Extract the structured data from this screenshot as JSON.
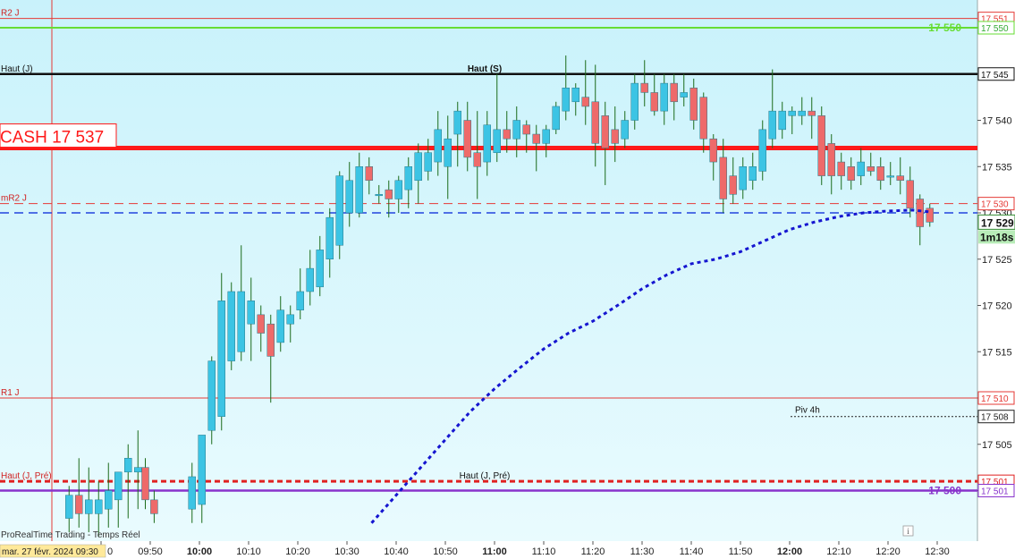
{
  "chart_data": {
    "type": "candlestick",
    "title": "",
    "xlabel": "",
    "ylabel": "",
    "ylim": [
      17496.5,
      17554.5
    ],
    "y_ticks": [
      17500,
      17505,
      17510,
      17515,
      17520,
      17525,
      17530,
      17535,
      17540,
      17545,
      17550
    ],
    "x_ticks": [
      {
        "m": -10,
        "label": "9:40",
        "bold": false
      },
      {
        "m": 0,
        "label": "09:50",
        "bold": false
      },
      {
        "m": 10,
        "label": "10:00",
        "bold": true
      },
      {
        "m": 20,
        "label": "10:10",
        "bold": false
      },
      {
        "m": 30,
        "label": "10:20",
        "bold": false
      },
      {
        "m": 40,
        "label": "10:30",
        "bold": false
      },
      {
        "m": 50,
        "label": "10:40",
        "bold": false
      },
      {
        "m": 60,
        "label": "10:50",
        "bold": false
      },
      {
        "m": 70,
        "label": "11:00",
        "bold": true
      },
      {
        "m": 80,
        "label": "11:10",
        "bold": false
      },
      {
        "m": 90,
        "label": "11:20",
        "bold": false
      },
      {
        "m": 100,
        "label": "11:30",
        "bold": false
      },
      {
        "m": 110,
        "label": "11:40",
        "bold": false
      },
      {
        "m": 120,
        "label": "11:50",
        "bold": false
      },
      {
        "m": 130,
        "label": "12:00",
        "bold": true
      },
      {
        "m": 140,
        "label": "12:10",
        "bold": false
      },
      {
        "m": 150,
        "label": "12:20",
        "bold": false
      },
      {
        "m": 160,
        "label": "12:30",
        "bold": false
      }
    ],
    "date_label": "mar. 27 févr. 2024 09:30",
    "watermark": "ProRealTime Trading - Temps Réel",
    "candles": [
      {
        "m": -16.5,
        "o": 17497.0,
        "h": 17500.5,
        "l": 17495.5,
        "c": 17499.5
      },
      {
        "m": -14.5,
        "o": 17499.5,
        "h": 17503.5,
        "l": 17496.0,
        "c": 17497.5
      },
      {
        "m": -12.5,
        "o": 17497.5,
        "h": 17502.5,
        "l": 17495.5,
        "c": 17499.0
      },
      {
        "m": -10.5,
        "o": 17497.5,
        "h": 17501.0,
        "l": 17495.0,
        "c": 17499.0
      },
      {
        "m": -8.5,
        "o": 17498.0,
        "h": 17503.0,
        "l": 17496.0,
        "c": 17500.0
      },
      {
        "m": -6.5,
        "o": 17499.0,
        "h": 17502.0,
        "l": 17496.0,
        "c": 17502.0
      },
      {
        "m": -4.5,
        "o": 17502.0,
        "h": 17505.0,
        "l": 17497.0,
        "c": 17503.5
      },
      {
        "m": -2.5,
        "o": 17502.0,
        "h": 17506.5,
        "l": 17498.0,
        "c": 17502.5
      },
      {
        "m": -1.0,
        "o": 17502.5,
        "h": 17503.5,
        "l": 17498.0,
        "c": 17499.0
      },
      {
        "m": 0.8,
        "o": 17499.0,
        "h": 17500.0,
        "l": 17496.5,
        "c": 17497.5
      },
      {
        "m": 8.5,
        "o": 17498.0,
        "h": 17503.0,
        "l": 17496.5,
        "c": 17501.5
      },
      {
        "m": 10.5,
        "o": 17498.5,
        "h": 17505.5,
        "l": 17496.5,
        "c": 17506.0
      },
      {
        "m": 12.5,
        "o": 17506.5,
        "h": 17514.5,
        "l": 17505.0,
        "c": 17514.0
      },
      {
        "m": 14.5,
        "o": 17508.0,
        "h": 17523.5,
        "l": 17506.5,
        "c": 17520.5
      },
      {
        "m": 16.5,
        "o": 17514.0,
        "h": 17522.5,
        "l": 17513.0,
        "c": 17521.5
      },
      {
        "m": 18.5,
        "o": 17515.0,
        "h": 17526.5,
        "l": 17514.0,
        "c": 17521.5
      },
      {
        "m": 20.5,
        "o": 17518.0,
        "h": 17523.0,
        "l": 17514.0,
        "c": 17520.5
      },
      {
        "m": 22.5,
        "o": 17519.0,
        "h": 17520.0,
        "l": 17515.0,
        "c": 17517.0
      },
      {
        "m": 24.5,
        "o": 17518.0,
        "h": 17519.0,
        "l": 17509.5,
        "c": 17514.5
      },
      {
        "m": 26.5,
        "o": 17516.0,
        "h": 17521.0,
        "l": 17515.0,
        "c": 17519.5
      },
      {
        "m": 28.5,
        "o": 17518.0,
        "h": 17520.0,
        "l": 17516.0,
        "c": 17519.0
      },
      {
        "m": 30.5,
        "o": 17519.5,
        "h": 17524.0,
        "l": 17518.5,
        "c": 17521.5
      },
      {
        "m": 32.5,
        "o": 17521.5,
        "h": 17526.0,
        "l": 17520.0,
        "c": 17524.0
      },
      {
        "m": 34.5,
        "o": 17522.0,
        "h": 17527.5,
        "l": 17521.0,
        "c": 17526.0
      },
      {
        "m": 36.5,
        "o": 17525.0,
        "h": 17530.5,
        "l": 17523.0,
        "c": 17529.5
      },
      {
        "m": 38.5,
        "o": 17526.5,
        "h": 17534.5,
        "l": 17525.0,
        "c": 17534.0
      },
      {
        "m": 40.5,
        "o": 17530.0,
        "h": 17535.5,
        "l": 17528.5,
        "c": 17533.5
      },
      {
        "m": 42.5,
        "o": 17530.0,
        "h": 17536.5,
        "l": 17529.5,
        "c": 17535.0
      },
      {
        "m": 44.5,
        "o": 17535.0,
        "h": 17536.0,
        "l": 17532.0,
        "c": 17533.5
      },
      {
        "m": 46.5,
        "o": 17532.0,
        "h": 17533.0,
        "l": 17531.0,
        "c": 17532.0
      },
      {
        "m": 48.5,
        "o": 17532.5,
        "h": 17533.5,
        "l": 17529.5,
        "c": 17531.5
      },
      {
        "m": 50.5,
        "o": 17531.5,
        "h": 17534.0,
        "l": 17530.0,
        "c": 17533.5
      },
      {
        "m": 52.5,
        "o": 17532.5,
        "h": 17536.0,
        "l": 17530.5,
        "c": 17535.0
      },
      {
        "m": 54.5,
        "o": 17533.5,
        "h": 17537.5,
        "l": 17531.0,
        "c": 17536.5
      },
      {
        "m": 56.5,
        "o": 17534.5,
        "h": 17538.0,
        "l": 17533.5,
        "c": 17536.5
      },
      {
        "m": 58.5,
        "o": 17535.5,
        "h": 17541.0,
        "l": 17534.0,
        "c": 17539.0
      },
      {
        "m": 60.5,
        "o": 17535.0,
        "h": 17540.5,
        "l": 17531.5,
        "c": 17538.0
      },
      {
        "m": 62.5,
        "o": 17538.5,
        "h": 17542.0,
        "l": 17535.0,
        "c": 17541.0
      },
      {
        "m": 64.5,
        "o": 17540.0,
        "h": 17542.0,
        "l": 17534.5,
        "c": 17536.0
      },
      {
        "m": 66.5,
        "o": 17536.5,
        "h": 17541.0,
        "l": 17531.5,
        "c": 17535.0
      },
      {
        "m": 68.5,
        "o": 17535.5,
        "h": 17541.0,
        "l": 17534.0,
        "c": 17539.5
      },
      {
        "m": 70.5,
        "o": 17536.5,
        "h": 17545.0,
        "l": 17535.5,
        "c": 17539.0
      },
      {
        "m": 72.5,
        "o": 17539.0,
        "h": 17541.0,
        "l": 17536.5,
        "c": 17538.0
      },
      {
        "m": 74.5,
        "o": 17538.0,
        "h": 17541.5,
        "l": 17536.0,
        "c": 17540.0
      },
      {
        "m": 76.5,
        "o": 17539.5,
        "h": 17540.0,
        "l": 17536.5,
        "c": 17538.5
      },
      {
        "m": 78.5,
        "o": 17538.5,
        "h": 17539.5,
        "l": 17534.5,
        "c": 17537.5
      },
      {
        "m": 80.5,
        "o": 17537.5,
        "h": 17539.5,
        "l": 17536.0,
        "c": 17539.0
      },
      {
        "m": 82.5,
        "o": 17539.0,
        "h": 17542.0,
        "l": 17538.5,
        "c": 17541.5
      },
      {
        "m": 84.5,
        "o": 17541.0,
        "h": 17547.0,
        "l": 17540.0,
        "c": 17543.5
      },
      {
        "m": 86.5,
        "o": 17542.0,
        "h": 17544.0,
        "l": 17540.5,
        "c": 17543.5
      },
      {
        "m": 88.5,
        "o": 17542.5,
        "h": 17546.5,
        "l": 17539.5,
        "c": 17541.5
      },
      {
        "m": 90.5,
        "o": 17542.0,
        "h": 17546.0,
        "l": 17535.0,
        "c": 17537.5
      },
      {
        "m": 92.5,
        "o": 17540.5,
        "h": 17542.0,
        "l": 17533.0,
        "c": 17537.0
      },
      {
        "m": 94.5,
        "o": 17539.0,
        "h": 17541.5,
        "l": 17535.5,
        "c": 17537.5
      },
      {
        "m": 96.5,
        "o": 17538.0,
        "h": 17541.0,
        "l": 17537.0,
        "c": 17540.0
      },
      {
        "m": 98.5,
        "o": 17540.0,
        "h": 17545.0,
        "l": 17539.0,
        "c": 17544.0
      },
      {
        "m": 100.5,
        "o": 17544.0,
        "h": 17546.5,
        "l": 17541.5,
        "c": 17543.0
      },
      {
        "m": 102.5,
        "o": 17543.0,
        "h": 17545.0,
        "l": 17540.5,
        "c": 17541.0
      },
      {
        "m": 104.5,
        "o": 17541.0,
        "h": 17545.0,
        "l": 17539.5,
        "c": 17544.0
      },
      {
        "m": 106.5,
        "o": 17544.0,
        "h": 17545.0,
        "l": 17540.0,
        "c": 17542.0
      },
      {
        "m": 108.5,
        "o": 17542.5,
        "h": 17545.0,
        "l": 17541.5,
        "c": 17543.0
      },
      {
        "m": 110.5,
        "o": 17543.5,
        "h": 17544.5,
        "l": 17539.0,
        "c": 17540.0
      },
      {
        "m": 112.5,
        "o": 17542.5,
        "h": 17543.0,
        "l": 17536.5,
        "c": 17538.0
      },
      {
        "m": 114.5,
        "o": 17538.0,
        "h": 17538.5,
        "l": 17533.5,
        "c": 17535.5
      },
      {
        "m": 116.5,
        "o": 17536.0,
        "h": 17538.0,
        "l": 17530.0,
        "c": 17531.5
      },
      {
        "m": 118.5,
        "o": 17534.0,
        "h": 17536.0,
        "l": 17531.0,
        "c": 17532.0
      },
      {
        "m": 120.5,
        "o": 17532.5,
        "h": 17536.0,
        "l": 17531.5,
        "c": 17535.0
      },
      {
        "m": 122.5,
        "o": 17533.5,
        "h": 17536.5,
        "l": 17532.5,
        "c": 17535.0
      },
      {
        "m": 124.5,
        "o": 17534.5,
        "h": 17540.0,
        "l": 17533.5,
        "c": 17539.0
      },
      {
        "m": 126.5,
        "o": 17538.0,
        "h": 17545.5,
        "l": 17537.0,
        "c": 17541.0
      },
      {
        "m": 128.5,
        "o": 17539.0,
        "h": 17542.0,
        "l": 17538.0,
        "c": 17541.0
      },
      {
        "m": 130.5,
        "o": 17540.5,
        "h": 17541.5,
        "l": 17538.5,
        "c": 17541.0
      },
      {
        "m": 132.5,
        "o": 17540.5,
        "h": 17542.5,
        "l": 17539.5,
        "c": 17541.0
      },
      {
        "m": 134.5,
        "o": 17541.0,
        "h": 17542.5,
        "l": 17538.0,
        "c": 17540.5
      },
      {
        "m": 136.5,
        "o": 17540.5,
        "h": 17541.5,
        "l": 17533.0,
        "c": 17534.0
      },
      {
        "m": 138.5,
        "o": 17537.5,
        "h": 17538.5,
        "l": 17532.0,
        "c": 17534.0
      },
      {
        "m": 140.5,
        "o": 17535.5,
        "h": 17536.5,
        "l": 17532.5,
        "c": 17534.0
      },
      {
        "m": 142.5,
        "o": 17535.0,
        "h": 17536.0,
        "l": 17532.5,
        "c": 17533.5
      },
      {
        "m": 144.5,
        "o": 17534.0,
        "h": 17537.0,
        "l": 17533.0,
        "c": 17535.5
      },
      {
        "m": 146.5,
        "o": 17535.0,
        "h": 17536.5,
        "l": 17534.0,
        "c": 17534.5
      },
      {
        "m": 148.5,
        "o": 17535.0,
        "h": 17536.0,
        "l": 17532.5,
        "c": 17533.5
      },
      {
        "m": 150.5,
        "o": 17534.0,
        "h": 17535.5,
        "l": 17533.0,
        "c": 17534.0
      },
      {
        "m": 152.5,
        "o": 17534.0,
        "h": 17536.0,
        "l": 17532.0,
        "c": 17533.5
      },
      {
        "m": 154.5,
        "o": 17533.5,
        "h": 17535.0,
        "l": 17529.5,
        "c": 17530.5
      },
      {
        "m": 156.5,
        "o": 17531.5,
        "h": 17532.0,
        "l": 17526.5,
        "c": 17528.5
      },
      {
        "m": 158.5,
        "o": 17530.5,
        "h": 17531.0,
        "l": 17528.5,
        "c": 17529.0
      }
    ],
    "moving_average": [
      {
        "m": 45.0,
        "v": 17496.5
      },
      {
        "m": 50.0,
        "v": 17499.5
      },
      {
        "m": 55.0,
        "v": 17502.5
      },
      {
        "m": 60.0,
        "v": 17505.5
      },
      {
        "m": 65.0,
        "v": 17508.5
      },
      {
        "m": 70.0,
        "v": 17511.0
      },
      {
        "m": 75.0,
        "v": 17513.2
      },
      {
        "m": 80.0,
        "v": 17515.3
      },
      {
        "m": 85.0,
        "v": 17517.0
      },
      {
        "m": 90.0,
        "v": 17518.3
      },
      {
        "m": 95.0,
        "v": 17520.0
      },
      {
        "m": 100.0,
        "v": 17521.8
      },
      {
        "m": 105.0,
        "v": 17523.3
      },
      {
        "m": 110.0,
        "v": 17524.5
      },
      {
        "m": 115.0,
        "v": 17525.0
      },
      {
        "m": 120.0,
        "v": 17525.8
      },
      {
        "m": 125.0,
        "v": 17527.0
      },
      {
        "m": 130.0,
        "v": 17528.2
      },
      {
        "m": 135.0,
        "v": 17529.0
      },
      {
        "m": 140.0,
        "v": 17529.6
      },
      {
        "m": 145.0,
        "v": 17530.0
      },
      {
        "m": 150.0,
        "v": 17530.2
      },
      {
        "m": 155.0,
        "v": 17530.3
      },
      {
        "m": 158.5,
        "v": 17530.1
      }
    ],
    "levels": [
      {
        "name": "R2 J",
        "value": 17551,
        "color": "#e53935",
        "style": "solid",
        "width": 1,
        "label": "R2 J",
        "tag": "17 551"
      },
      {
        "name": "green",
        "value": 17550,
        "color": "#66dd33",
        "style": "solid",
        "width": 2,
        "label": "",
        "tag": "17 550",
        "inline_text": "17 550"
      },
      {
        "name": "Haut (J)",
        "value": 17545,
        "color": "#111111",
        "style": "solid",
        "width": 2.5,
        "label": "Haut (J)",
        "tag": "17 545",
        "mid_text": "Haut (S)"
      },
      {
        "name": "CASH",
        "value": 17537,
        "color": "#ff1a1a",
        "style": "solid",
        "width": 5,
        "label": "",
        "tag": ""
      },
      {
        "name": "mR2 J",
        "value": 17531,
        "color": "#e53935",
        "style": "dashed",
        "width": 1,
        "label": "mR2 J",
        "tag": "17 530"
      },
      {
        "name": "blue",
        "value": 17530,
        "color": "#2244dd",
        "style": "dashed",
        "width": 1.5,
        "label": "",
        "tag": ""
      },
      {
        "name": "R1 J",
        "value": 17510,
        "color": "#e53935",
        "style": "solid",
        "width": 1,
        "label": "R1 J",
        "tag": "17 510"
      },
      {
        "name": "Piv 4h",
        "value": 17508,
        "color": "#222222",
        "style": "dotted",
        "width": 1,
        "label": "",
        "tag": "17 508",
        "piv_text": "Piv 4h"
      },
      {
        "name": "Haut (J, Pré)",
        "value": 17501,
        "color": "#e02020",
        "style": "dashed",
        "width": 3,
        "label": "Haut (J, Pré)",
        "tag": "17 501",
        "mid_text": "Haut (J, Pré)"
      },
      {
        "name": "purple",
        "value": 17500,
        "color": "#8833cc",
        "style": "solid",
        "width": 2.5,
        "label": "",
        "tag": "17 501",
        "inline_text": "17 500"
      }
    ],
    "cash_label": "CASH 17 537",
    "last_price": "17 529",
    "countdown": "1m18s",
    "colors": {
      "up": "#3cc4e4",
      "down": "#ee6a6a",
      "wick": "#1a6b1a",
      "ma": "#1515d0",
      "bg_top": "#c9f2fb",
      "bg_bottom": "#e9fbfe",
      "price_tag": "#2e8b2e",
      "countdown_tag": "#b8ecb8"
    }
  }
}
